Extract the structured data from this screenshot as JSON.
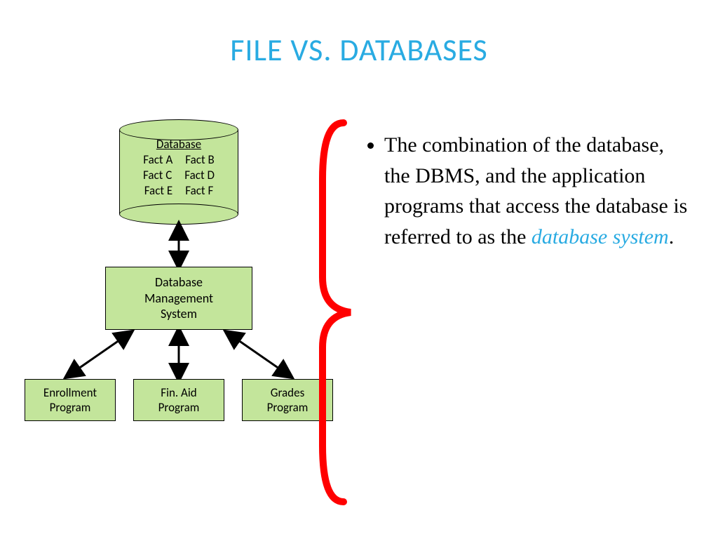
{
  "title": "FILE VS. DATABASES",
  "diagram": {
    "db_label": "Database",
    "facts": {
      "a": "Fact A",
      "b": "Fact B",
      "c": "Fact C",
      "d": "Fact D",
      "e": "Fact E",
      "f": "Fact F"
    },
    "dbms": "Database\nManagement\nSystem",
    "programs": {
      "p1": "Enrollment\nProgram",
      "p2": "Fin. Aid\nProgram",
      "p3": "Grades\nProgram"
    }
  },
  "bullet": {
    "pre": "The combination of the database, the DBMS, and the application programs that access the database is referred to as the ",
    "hl": "database system",
    "post": "."
  },
  "colors": {
    "accent": "#29abe2",
    "shape_fill": "#c3e59b",
    "brace": "#ff0000"
  }
}
